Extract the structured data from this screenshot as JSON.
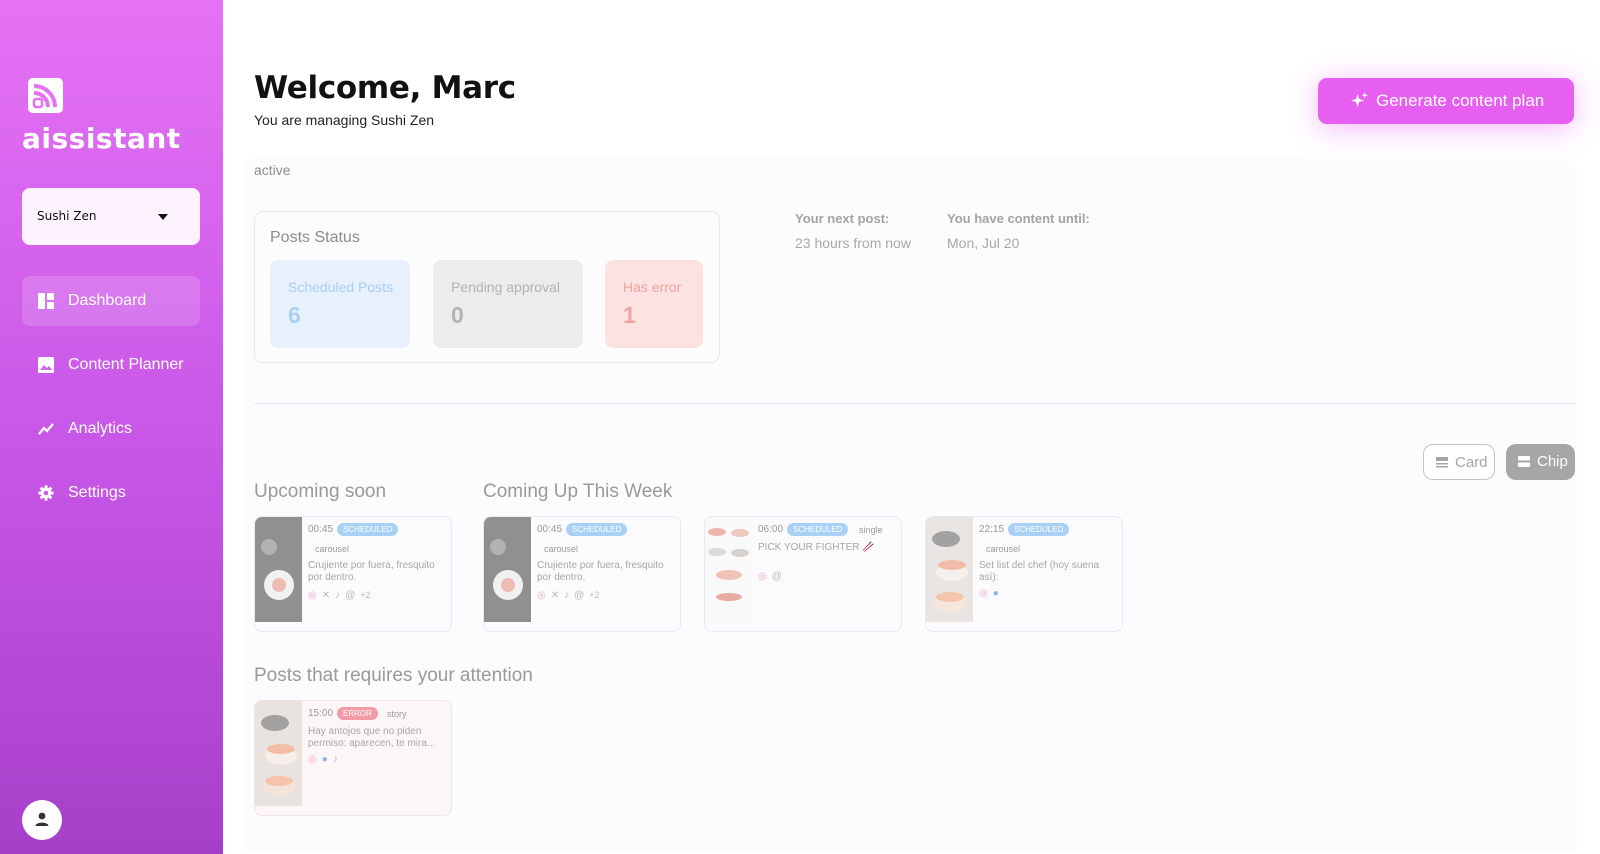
{
  "sidebar": {
    "logo_text": "aissistant",
    "brand_select": "Sushi Zen",
    "nav": [
      {
        "label": "Dashboard",
        "icon": "dashboard-icon",
        "active": true
      },
      {
        "label": "Content Planner",
        "icon": "image-icon",
        "active": false
      },
      {
        "label": "Analytics",
        "icon": "trending-icon",
        "active": false
      },
      {
        "label": "Settings",
        "icon": "gear-icon",
        "active": false
      }
    ]
  },
  "header": {
    "title": "Welcome, Marc",
    "subtitle": "You are managing Sushi Zen",
    "generate_label": "Generate content plan"
  },
  "status_tag": "active",
  "posts_status": {
    "title": "Posts Status",
    "scheduled": {
      "label": "Scheduled Posts",
      "value": "6"
    },
    "pending": {
      "label": "Pending approval",
      "value": "0"
    },
    "error": {
      "label": "Has error",
      "value": "1"
    }
  },
  "info": {
    "next_post_label": "Your next post:",
    "next_post_value": "23 hours from now",
    "content_until_label": "You have content until:",
    "content_until_value": "Mon, Jul 20"
  },
  "view_toggle": {
    "card": "Card",
    "chip": "Chip"
  },
  "sections": {
    "upcoming": "Upcoming soon",
    "week": "Coming Up This Week",
    "attention": "Posts that requires your attention"
  },
  "posts": {
    "upcoming": [
      {
        "time": "00:45",
        "status": "SCHEDULED",
        "type": "carousel",
        "caption": "Crujiente por fuera, fresquito por dentro.",
        "more": "+2"
      }
    ],
    "week": [
      {
        "time": "00:45",
        "status": "SCHEDULED",
        "type": "carousel",
        "caption": "Crujiente por fuera, fresquito por dentro.",
        "more": "+2"
      },
      {
        "time": "06:00",
        "status": "SCHEDULED",
        "type": "single",
        "caption": "PICK YOUR FIGHTER 🥢"
      },
      {
        "time": "22:15",
        "status": "SCHEDULED",
        "type": "carousel",
        "caption": "Set list del chef (hoy suena así):"
      }
    ],
    "attention": [
      {
        "time": "15:00",
        "status": "ERROR",
        "type": "story",
        "caption": "Hay antojos que no piden permiso: aparecen, te mira..."
      }
    ]
  },
  "colors": {
    "sidebar_top": "#e572f4",
    "sidebar_bottom": "#a63fc8",
    "accent": "#e65ff1",
    "scheduled_bg": "#e6f1fd",
    "error_bg": "#fde2e2"
  }
}
